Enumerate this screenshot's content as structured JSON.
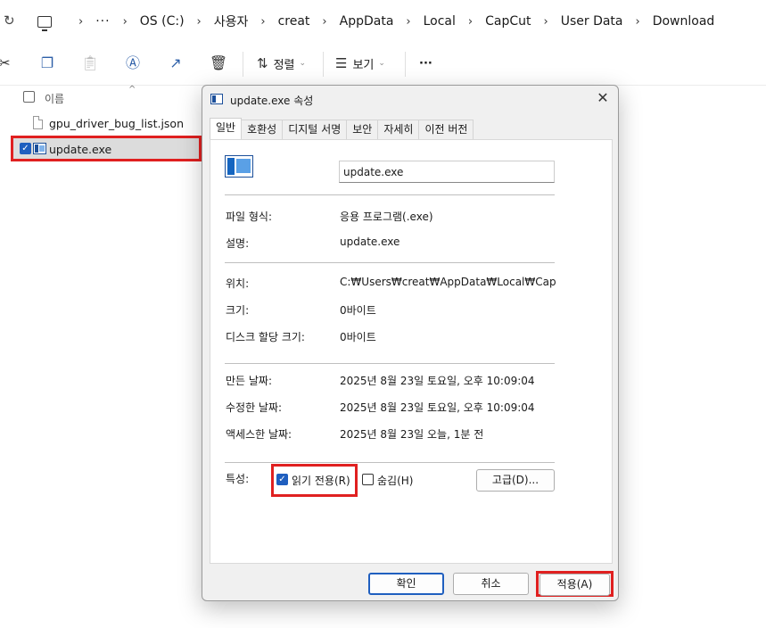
{
  "explorer": {
    "refresh_icon": "refresh-icon",
    "breadcrumb": {
      "ellipsis": "···",
      "items": [
        "OS (C:)",
        "사용자",
        "creat",
        "AppData",
        "Local",
        "CapCut",
        "User Data",
        "Download"
      ]
    },
    "toolbar": {
      "sort_label": "정렬",
      "view_label": "보기",
      "more_label": "···"
    },
    "list": {
      "name_header": "이름",
      "files": [
        {
          "name": "gpu_driver_bug_list.json",
          "selected": false
        },
        {
          "name": "update.exe",
          "selected": true
        }
      ]
    }
  },
  "dialog": {
    "title": "update.exe 속성",
    "close_label": "✕",
    "tabs": [
      "일반",
      "호환성",
      "디지털 서명",
      "보안",
      "자세히",
      "이전 버전"
    ],
    "active_tab": "일반",
    "filename": "update.exe",
    "file_type_label": "파일 형식:",
    "file_type_value": "응용 프로그램(.exe)",
    "description_label": "설명:",
    "description_value": "update.exe",
    "location_label": "위치:",
    "location_value": "C:₩Users₩creat₩AppData₩Local₩CapCut₩U",
    "size_label": "크기:",
    "size_value": "0바이트",
    "disk_size_label": "디스크 할당 크기:",
    "disk_size_value": "0바이트",
    "created_label": "만든 날짜:",
    "created_value": "2025년 8월 23일 토요일, 오후 10:09:04",
    "modified_label": "수정한 날짜:",
    "modified_value": "2025년 8월 23일 토요일, 오후 10:09:04",
    "accessed_label": "액세스한 날짜:",
    "accessed_value": "2025년 8월 23일 오늘, 1분 전",
    "attributes_label": "특성:",
    "readonly_label": "읽기 전용(R)",
    "readonly_checked": true,
    "hidden_label": "숨김(H)",
    "hidden_checked": false,
    "advanced_label": "고급(D)...",
    "ok_label": "확인",
    "cancel_label": "취소",
    "apply_label": "적용(A)"
  },
  "colors": {
    "highlight_red": "#e02020",
    "accent_blue": "#1f5fbf"
  }
}
